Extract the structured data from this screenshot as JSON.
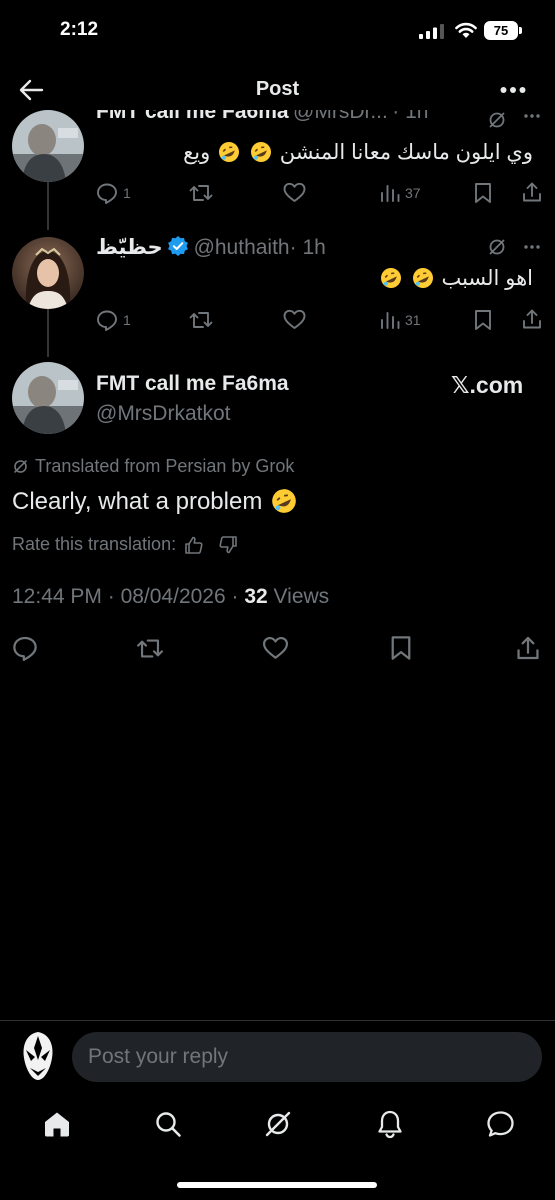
{
  "status_bar": {
    "time": "2:12",
    "battery": "75"
  },
  "header": {
    "title": "Post"
  },
  "replies": [
    {
      "name": "FMT call me Fa6ma",
      "handle": "@MrsDr...",
      "time": "· 1h",
      "text": "وي ايلون ماسك معانا المنشن",
      "text_suffix": "ويع",
      "reply_count": "1",
      "views": "37"
    },
    {
      "name": "حظيّظ",
      "handle": "@huthaith",
      "time": "· 1h",
      "text": "اهو السبب",
      "reply_count": "1",
      "views": "31"
    }
  ],
  "main_post": {
    "name": "FMT call me Fa6ma",
    "handle": "@MrsDrkatkot",
    "watermark": "𝕏.com",
    "translated_label": "Translated from Persian by Grok",
    "text": "Clearly, what a problem",
    "rate_label": "Rate this translation:",
    "time": "12:44 PM",
    "date": "08/04/2026",
    "views_count": "32",
    "views_label": "Views"
  },
  "reply_box": {
    "placeholder": "Post your reply"
  },
  "icons": {
    "back": "back-arrow-icon",
    "more": "more-icon",
    "reply": "reply-icon",
    "repost": "repost-icon",
    "like": "heart-icon",
    "views": "views-icon",
    "bookmark": "bookmark-icon",
    "share": "share-icon",
    "grok": "grok-icon",
    "verified": "verified-badge-icon",
    "emoji": "rofl-emoji"
  },
  "colors": {
    "background": "#000000",
    "text": "#e7e9ea",
    "muted": "#71767b",
    "verified": "#1d9bf0",
    "input_bg": "#202327"
  }
}
